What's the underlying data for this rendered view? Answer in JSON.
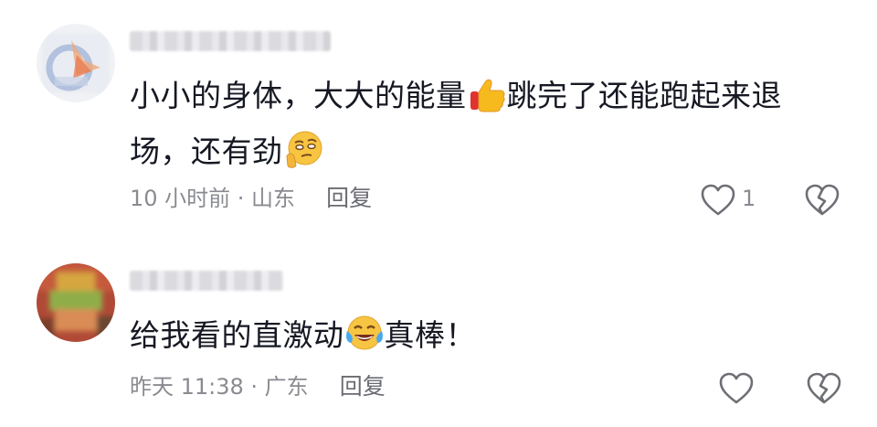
{
  "comments": [
    {
      "username": "",
      "text_part1": "小小的身体，大大的能量",
      "emoji1": "thumbs-up",
      "text_part2": "跳完了还能跑起来退场，还有劲",
      "emoji2": "thinking-face",
      "time_location": "10 小时前 · 山东",
      "reply_label": "回复",
      "like_count": "1"
    },
    {
      "username": "",
      "text_part1": "给我看的直激动",
      "emoji1": "tears-of-joy",
      "text_part2": "真棒！",
      "time_location": "昨天 11:38 · 广东",
      "reply_label": "回复",
      "like_count": ""
    }
  ],
  "colors": {
    "text": "#161823",
    "meta": "#8a8b91",
    "icon_stroke": "#6e6f75"
  }
}
